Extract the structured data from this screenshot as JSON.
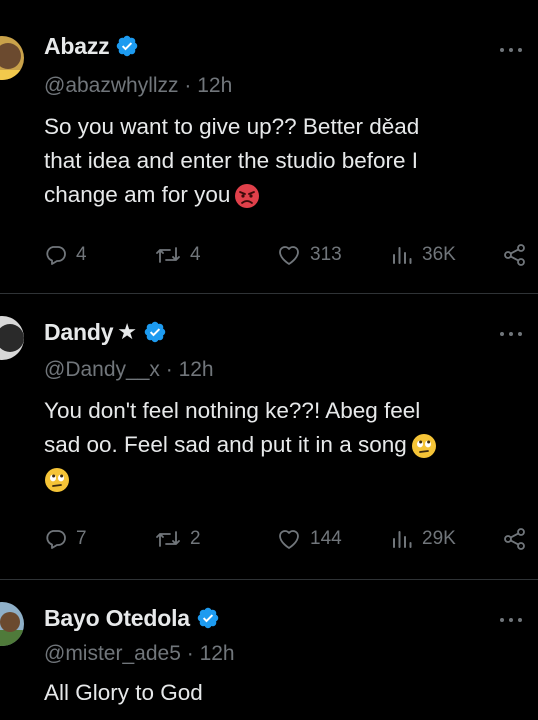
{
  "tweets": [
    {
      "name": "Abazz",
      "has_star": false,
      "handle": "@abazwhyllzz",
      "time": "12h",
      "text_lines": [
        "So you want to give up?? Better děad",
        "that idea and enter the studio before I",
        "change am for you"
      ],
      "trailing_emoji": "angry-face",
      "replies": "4",
      "reposts": "4",
      "likes": "313",
      "views": "36K"
    },
    {
      "name": "Dandy",
      "has_star": true,
      "star": "★",
      "handle": "@Dandy__x",
      "time": "12h",
      "text_lines": [
        "You don't feel nothing ke??! Abeg feel",
        "sad oo. Feel sad and put it in a song"
      ],
      "trailing_emoji": "rolling-eyes-face",
      "replies": "7",
      "reposts": "2",
      "likes": "144",
      "views": "29K"
    },
    {
      "name": "Bayo Otedola",
      "has_star": false,
      "handle": "@mister_ade5",
      "time": "12h",
      "text_lines": [
        "All Glory to God"
      ]
    }
  ],
  "separator": "·",
  "colors": {
    "background": "#000000",
    "text": "#e7e9ea",
    "muted": "#71767b",
    "verified": "#1d9bf0",
    "divider": "#2f3336"
  }
}
